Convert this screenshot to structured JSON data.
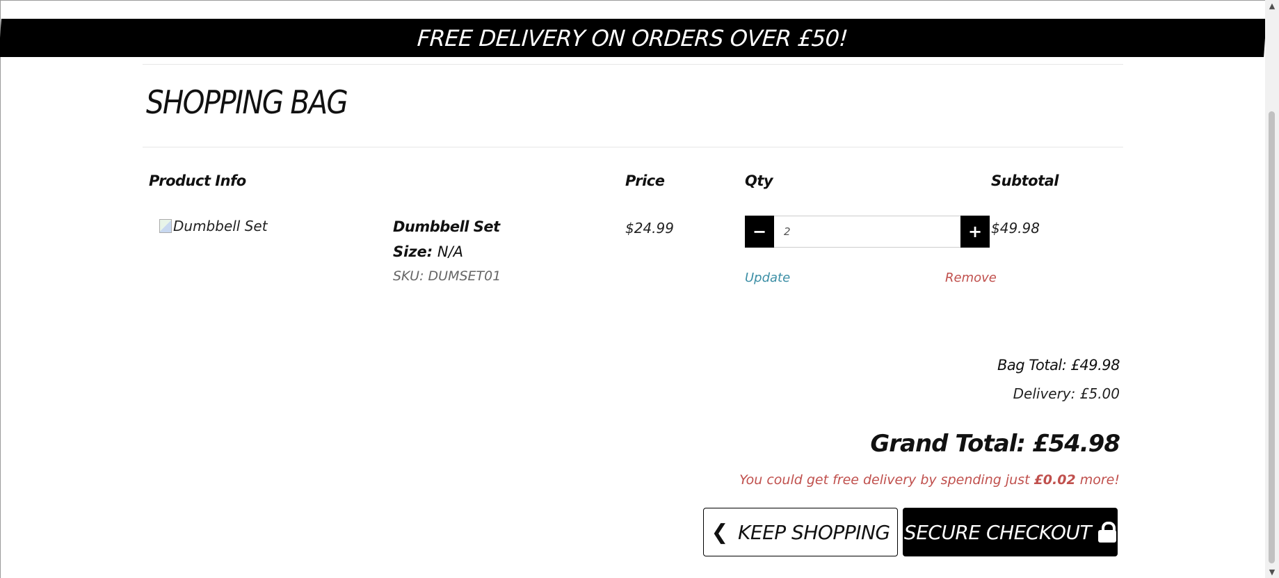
{
  "banner": {
    "text": "FREE DELIVERY ON ORDERS OVER £50!"
  },
  "page_title": "SHOPPING BAG",
  "table": {
    "headers": {
      "product": "Product Info",
      "price": "Price",
      "qty": "Qty",
      "subtotal": "Subtotal"
    },
    "rows": [
      {
        "image_alt": "Dumbbell Set",
        "name": "Dumbbell Set",
        "size_label": "Size:",
        "size_value": "N/A",
        "sku": "SKU: DUMSET01",
        "price": "$24.99",
        "qty": "2",
        "subtotal": "$49.98",
        "update_label": "Update",
        "remove_label": "Remove"
      }
    ]
  },
  "summary": {
    "bag_total": "Bag Total: £49.98",
    "delivery": "Delivery: £5.00",
    "grand_total": "Grand Total: £54.98",
    "free_msg_prefix": "You could get free delivery by spending just",
    "free_msg_amount": "£0.02",
    "free_msg_suffix": "more!"
  },
  "buttons": {
    "keep_shopping": "KEEP SHOPPING",
    "secure_checkout": "SECURE CHECKOUT"
  },
  "icons": {
    "minus": "minus-icon",
    "plus": "plus-icon",
    "chevron": "chevron-left-icon",
    "lock": "lock-icon"
  },
  "colors": {
    "accent_link": "#3b8ea5",
    "danger": "#c0504d",
    "primary": "#000000"
  }
}
